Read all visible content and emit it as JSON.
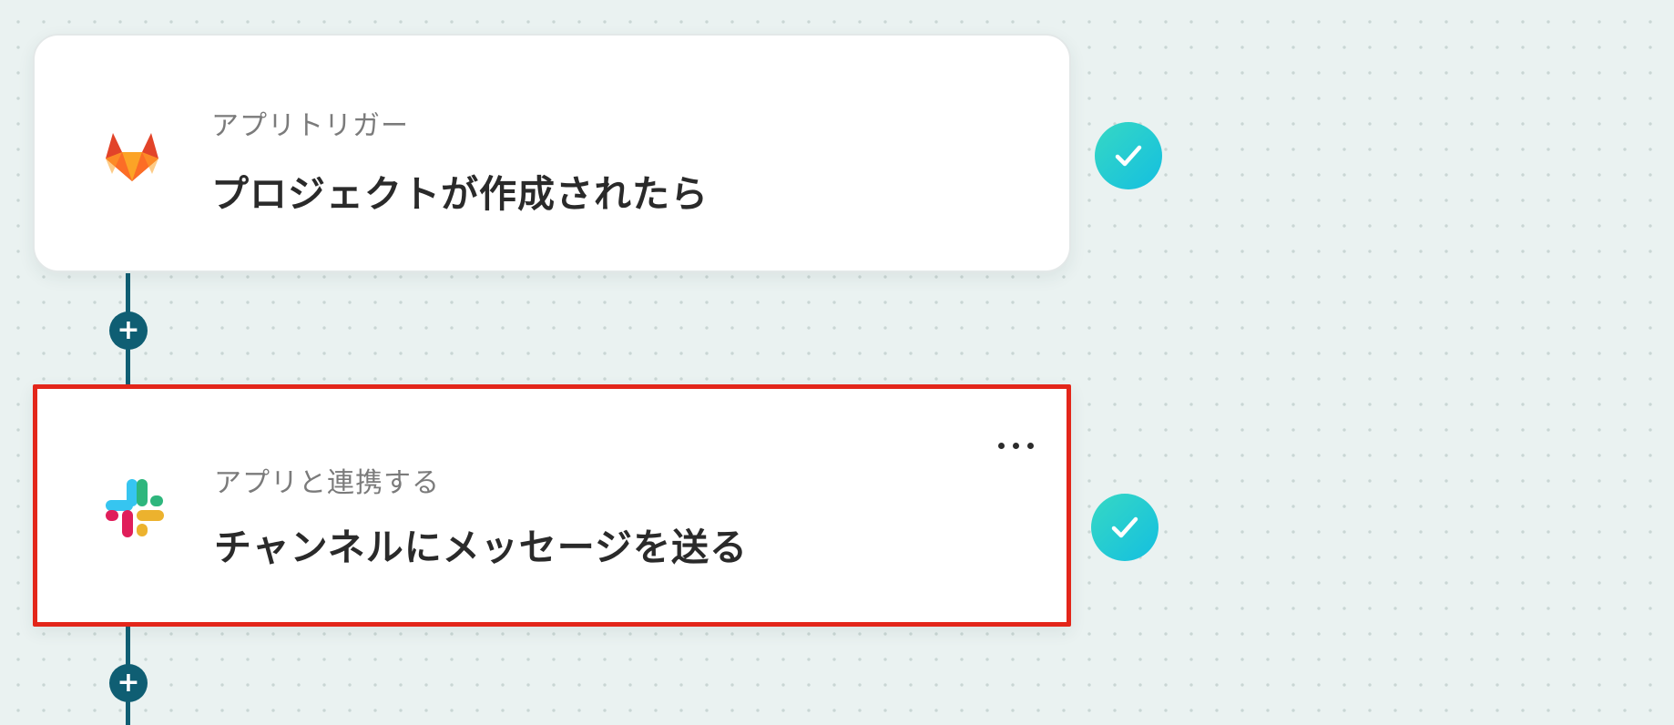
{
  "flow": {
    "steps": [
      {
        "kind": "アプリトリガー",
        "title": "プロジェクトが作成されたら",
        "app_icon": "gitlab-icon",
        "status": "completed"
      },
      {
        "kind": "アプリと連携する",
        "title": "チャンネルにメッセージを送る",
        "app_icon": "slack-icon",
        "status": "completed",
        "highlighted": true
      }
    ],
    "add_step_symbol": "+",
    "colors": {
      "connector": "#0f5e73",
      "check_gradient_start": "#36d8c4",
      "check_gradient_end": "#14bfe0",
      "highlight_border": "#e3261a",
      "canvas_background": "#eaf2f1"
    }
  }
}
